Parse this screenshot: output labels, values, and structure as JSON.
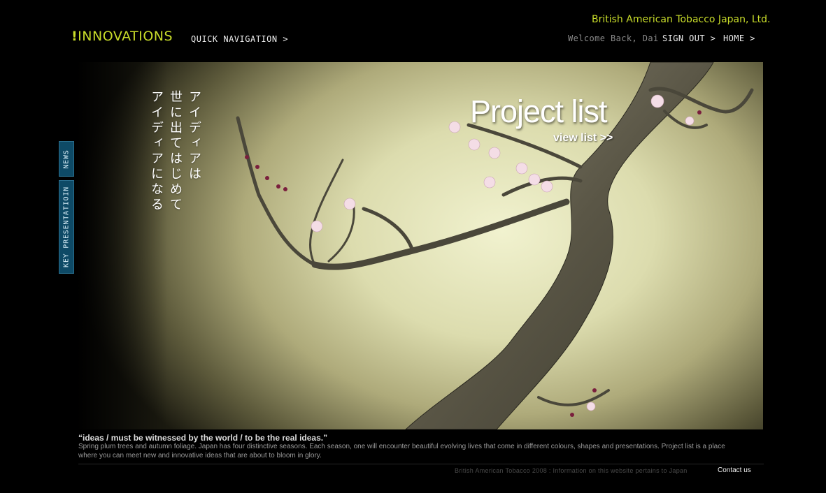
{
  "header": {
    "logo_mark": "!",
    "logo_text": "INNOVATIONS",
    "quick_nav": "QUICK NAVIGATION >",
    "company": "British American Tobacco Japan, Ltd.",
    "welcome": "Welcome Back, Dai",
    "sign_out": "SIGN OUT >",
    "home": "HOME >"
  },
  "side_tabs": {
    "news": "NEWS",
    "key_presentation": "KEY PRESENTATIOIN"
  },
  "hero": {
    "vertical_lines": [
      "アイディアは",
      "世に出てはじめて",
      "アイディアになる"
    ],
    "title": "Project list",
    "view_list": "view list >>"
  },
  "caption": {
    "quote": "“ideas / must be witnessed by the world / to be the real ideas.”",
    "description": "Spring plum trees and autumn foliage. Japan has four distinctive seasons. Each season, one will encounter beautiful evolving lives that come in different colours, shapes and presentations. Project list is a place where you can meet new and innovative ideas that are about to bloom in glory."
  },
  "footer": {
    "copyright": "British American Tobacco 2008 : Information on this website pertains to Japan",
    "contact": "Contact us"
  },
  "colors": {
    "accent_lime": "#c8dc2a",
    "tab_blue": "#0e4a66",
    "background": "#000000"
  }
}
